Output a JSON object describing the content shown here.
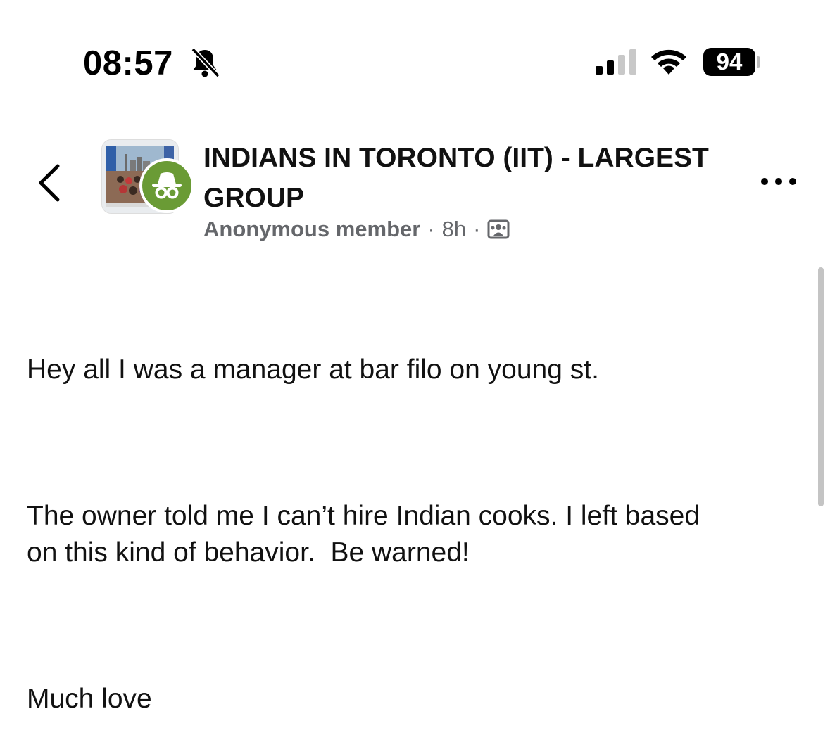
{
  "status_bar": {
    "time": "08:57",
    "silent_icon": "bell-slash-icon",
    "signal_icon": "cellular-signal-icon",
    "wifi_icon": "wifi-icon",
    "battery_level": "94"
  },
  "post_header": {
    "back_icon": "chevron-left-icon",
    "group_name": "INDIANS IN TORONTO (IIT) - LARGEST GROUP",
    "author": "Anonymous member",
    "separator": "·",
    "time_ago": "8h",
    "audience_icon": "members-only-icon",
    "more_icon": "more-horizontal-icon",
    "badge_icon": "incognito-icon",
    "badge_color": "#6a9b35"
  },
  "post": {
    "paragraphs": [
      "Hey all I was a manager at bar filo on young st.",
      "The owner told me I can’t hire Indian cooks. I left based\non this kind of behavior.  Be warned!",
      "Much love"
    ]
  }
}
